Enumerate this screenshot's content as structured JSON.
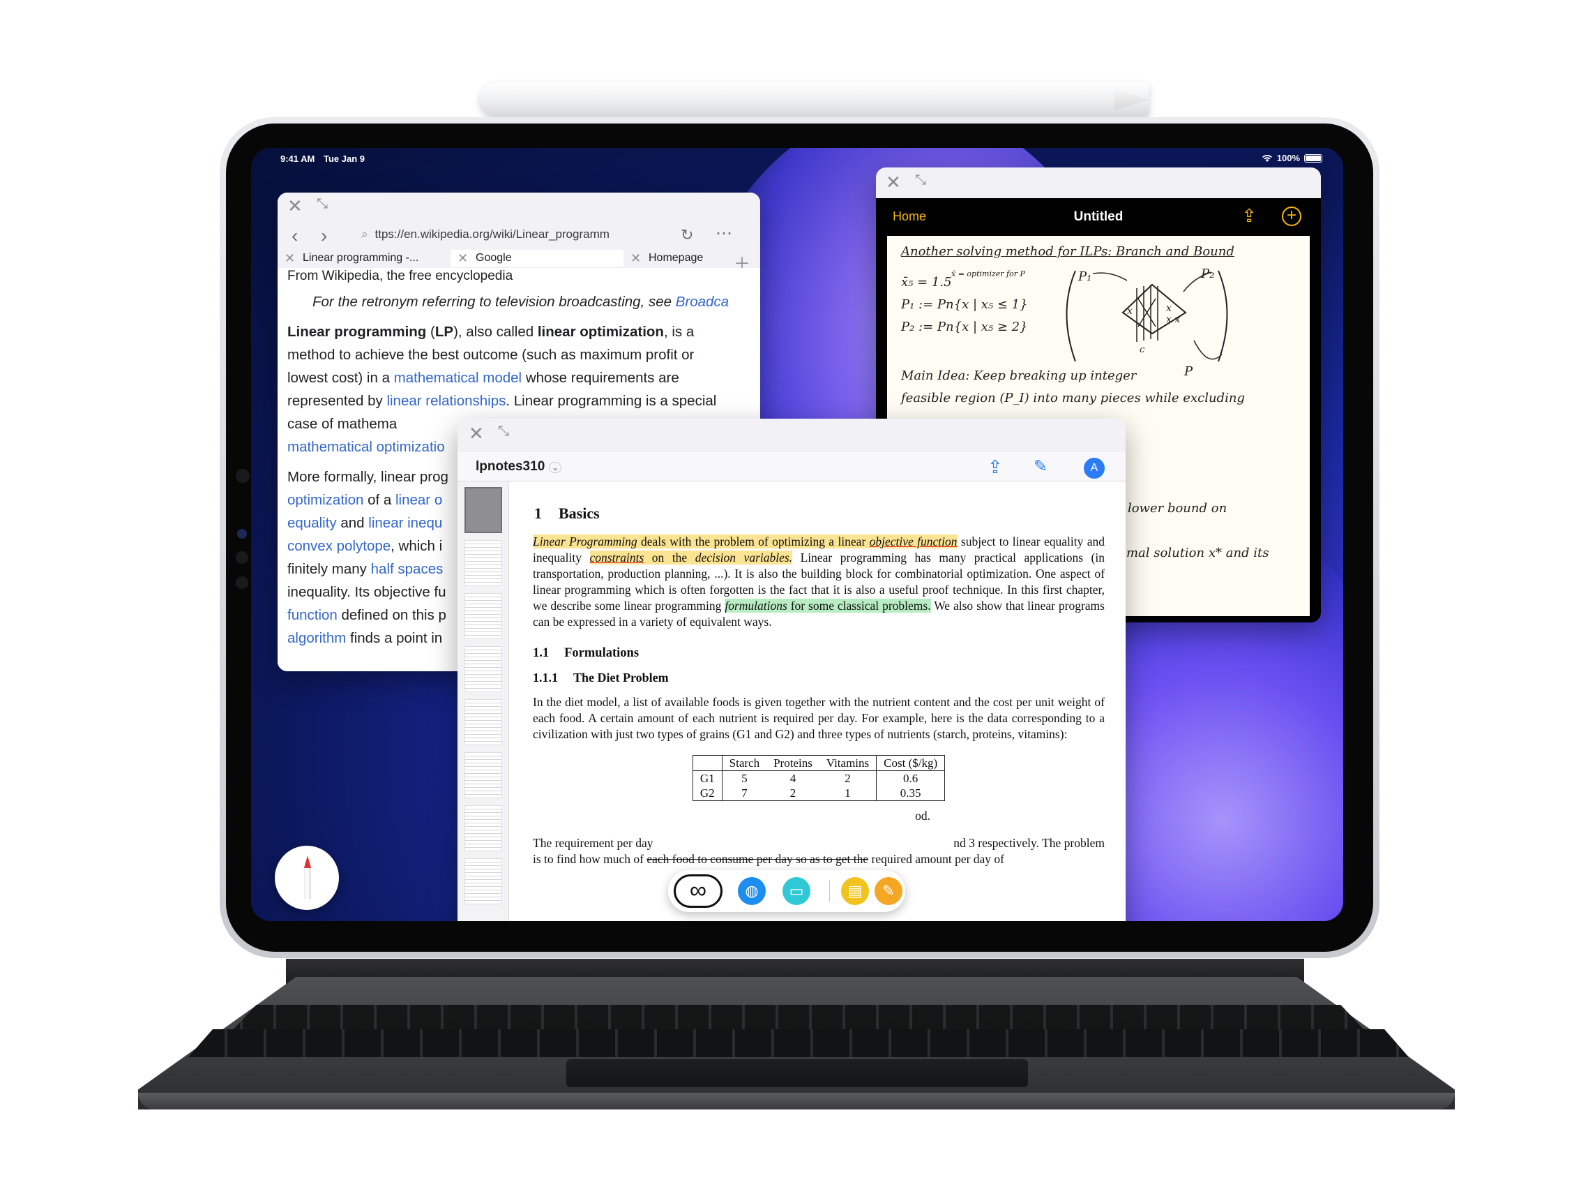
{
  "status_bar": {
    "time": "9:41 AM",
    "date": "Tue Jan 9",
    "battery": "100%"
  },
  "browser": {
    "url": "ttps://en.wikipedia.org/wiki/Linear_programm",
    "tabs": [
      {
        "label": "Linear programming -..."
      },
      {
        "label": "Google"
      },
      {
        "label": "Homepage"
      }
    ],
    "subtitle": "From Wikipedia, the free encyclopedia",
    "hatnote": "For the retronym referring to television broadcasting, see ",
    "hatnote_link": "Broadca",
    "p1": {
      "t1": "Linear programming",
      "t2": " (",
      "t3": "LP",
      "t4": "), also called ",
      "t5": "linear optimization",
      "t6": ", is a method to achieve the best outcome (such as maximum profit or lowest cost) in a ",
      "l1": "mathematical model",
      "t7": " whose requirements are represented by ",
      "l2": "linear relationships",
      "t8": ". Linear programming is a special case of mathema",
      "l3": "mathematical optimizatio"
    },
    "p2": {
      "t1": "More formally, linear prog",
      "l1": "optimization",
      "t2": " of a ",
      "l2": "linear o",
      "l3": "equality",
      "t3": " and ",
      "l4": "linear inequ",
      "l5": "convex polytope",
      "t4": ", which i",
      "t5": "finitely many ",
      "l6": "half spaces",
      "t6": "inequality. Its objective fu",
      "l7": "function",
      "t7": " defined on this p",
      "l8": "algorithm",
      "t8": " finds a point in"
    }
  },
  "notes": {
    "home": "Home",
    "title": "Untitled",
    "lines": {
      "l1": "Another solving method for ILPs: Branch and Bound",
      "l2": "x̄₅ = 1.5",
      "l2b": "x̄ = optimizer for P",
      "l3": "P₁ := Pn{x | x₅ ≤ 1}",
      "l4": "P₂ := Pn{x | x₅ ≥ 2}",
      "p1": "P₁",
      "p2": "P₂",
      "c": "c",
      "l5": "Main Idea: Keep breaking up integer",
      "l5b": "P",
      "l6": "feasible region (P_I) into many pieces while excluding",
      "l7": "s lower bound on",
      "l8": "timal solution x* and its"
    }
  },
  "pdf": {
    "name": "lpnotes310",
    "section_num": "1",
    "section_title": "Basics",
    "p1": {
      "a": "Linear Programming",
      "b": " deals with the problem of optimizing a linear ",
      "c": "objective function",
      "d": " subject to linear equality and inequality ",
      "e": "constraints",
      "f": " on the ",
      "g": "decision variables.",
      "h": " Linear programming has many practical applications (in transportation, production planning, ...). It is also the building block for combinatorial optimization. One aspect of linear programming which is often forgotten is the fact that it is also a useful proof technique. In this first chapter, we describe some linear programming ",
      "i": "formulations",
      "j": " for some classical problems.",
      "k": " We also show that linear programs can be expressed in a variety of equivalent ways."
    },
    "subsection_num": "1.1",
    "subsection_title": "Formulations",
    "subsub_num": "1.1.1",
    "subsub_title": "The Diet Problem",
    "p2": "In the diet model, a list of available foods is given together with the nutrient content and the cost per unit weight of each food. A certain amount of each nutrient is required per day. For example, here is the data corresponding to a civilization with just two types of grains (G1 and G2) and three types of nutrients (starch, proteins, vitamins):",
    "table": {
      "headers": [
        "",
        "Starch",
        "Proteins",
        "Vitamins",
        "Cost ($/kg)"
      ],
      "rows": [
        [
          "G1",
          "5",
          "4",
          "2",
          "0.6"
        ],
        [
          "G2",
          "7",
          "2",
          "1",
          "0.35"
        ]
      ]
    },
    "after_table_fragment": "od.",
    "p3a": "The requirement per day",
    "p3b": "nd 3 respectively. The problem",
    "p4a": "is to find how much of ",
    "p4s": "each food to consume per day so as to get the",
    "p4b": " required amount per day of"
  }
}
